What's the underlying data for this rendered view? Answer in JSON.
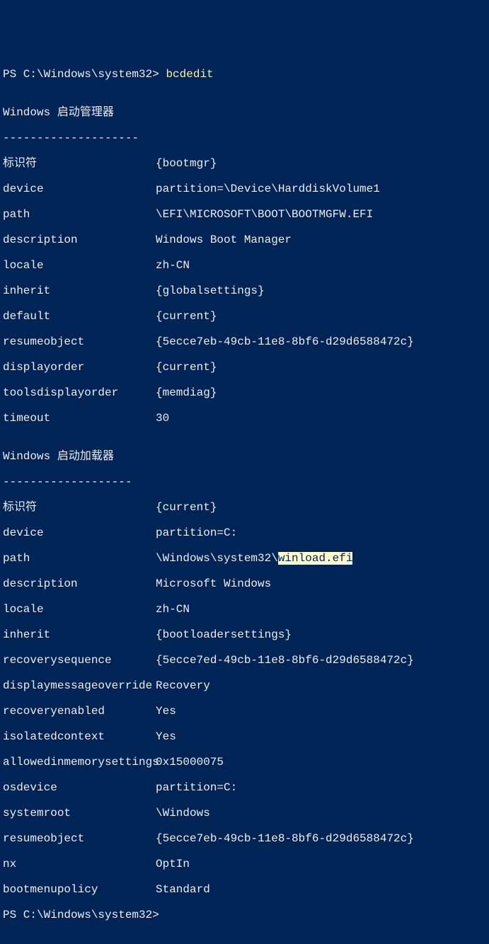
{
  "prompt1": "PS C:\\Windows\\system32> ",
  "command": "bcdedit",
  "blank": "",
  "section1_title": "Windows 启动管理器",
  "section1_underline": "--------------------",
  "section2_title": "Windows 启动加载器",
  "section2_underline": "-------------------",
  "s1": {
    "k0": "标识符",
    "v0": "{bootmgr}",
    "k1": "device",
    "v1": "partition=\\Device\\HarddiskVolume1",
    "k2": "path",
    "v2": "\\EFI\\MICROSOFT\\BOOT\\BOOTMGFW.EFI",
    "k3": "description",
    "v3": "Windows Boot Manager",
    "k4": "locale",
    "v4": "zh-CN",
    "k5": "inherit",
    "v5": "{globalsettings}",
    "k6": "default",
    "v6": "{current}",
    "k7": "resumeobject",
    "v7": "{5ecce7eb-49cb-11e8-8bf6-d29d6588472c}",
    "k8": "displayorder",
    "v8": "{current}",
    "k9": "toolsdisplayorder",
    "v9": "{memdiag}",
    "k10": "timeout",
    "v10": "30"
  },
  "s2": {
    "k0": "标识符",
    "v0": "{current}",
    "k1": "device",
    "v1": "partition=C:",
    "k2": "path",
    "v2a": "\\Windows\\system32\\",
    "v2b": "winload.efi",
    "k3": "description",
    "v3": "Microsoft Windows",
    "k4": "locale",
    "v4": "zh-CN",
    "k5": "inherit",
    "v5": "{bootloadersettings}",
    "k6": "recoverysequence",
    "v6": "{5ecce7ed-49cb-11e8-8bf6-d29d6588472c}",
    "k7": "displaymessageoverride",
    "v7": "Recovery",
    "k8": "recoveryenabled",
    "v8": "Yes",
    "k9": "isolatedcontext",
    "v9": "Yes",
    "k10": "allowedinmemorysettings",
    "v10": "0x15000075",
    "k11": "osdevice",
    "v11": "partition=C:",
    "k12": "systemroot",
    "v12": "\\Windows",
    "k13": "resumeobject",
    "v13": "{5ecce7eb-49cb-11e8-8bf6-d29d6588472c}",
    "k14": "nx",
    "v14": "OptIn",
    "k15": "bootmenupolicy",
    "v15": "Standard"
  },
  "prompt2": "PS C:\\Windows\\system32>"
}
